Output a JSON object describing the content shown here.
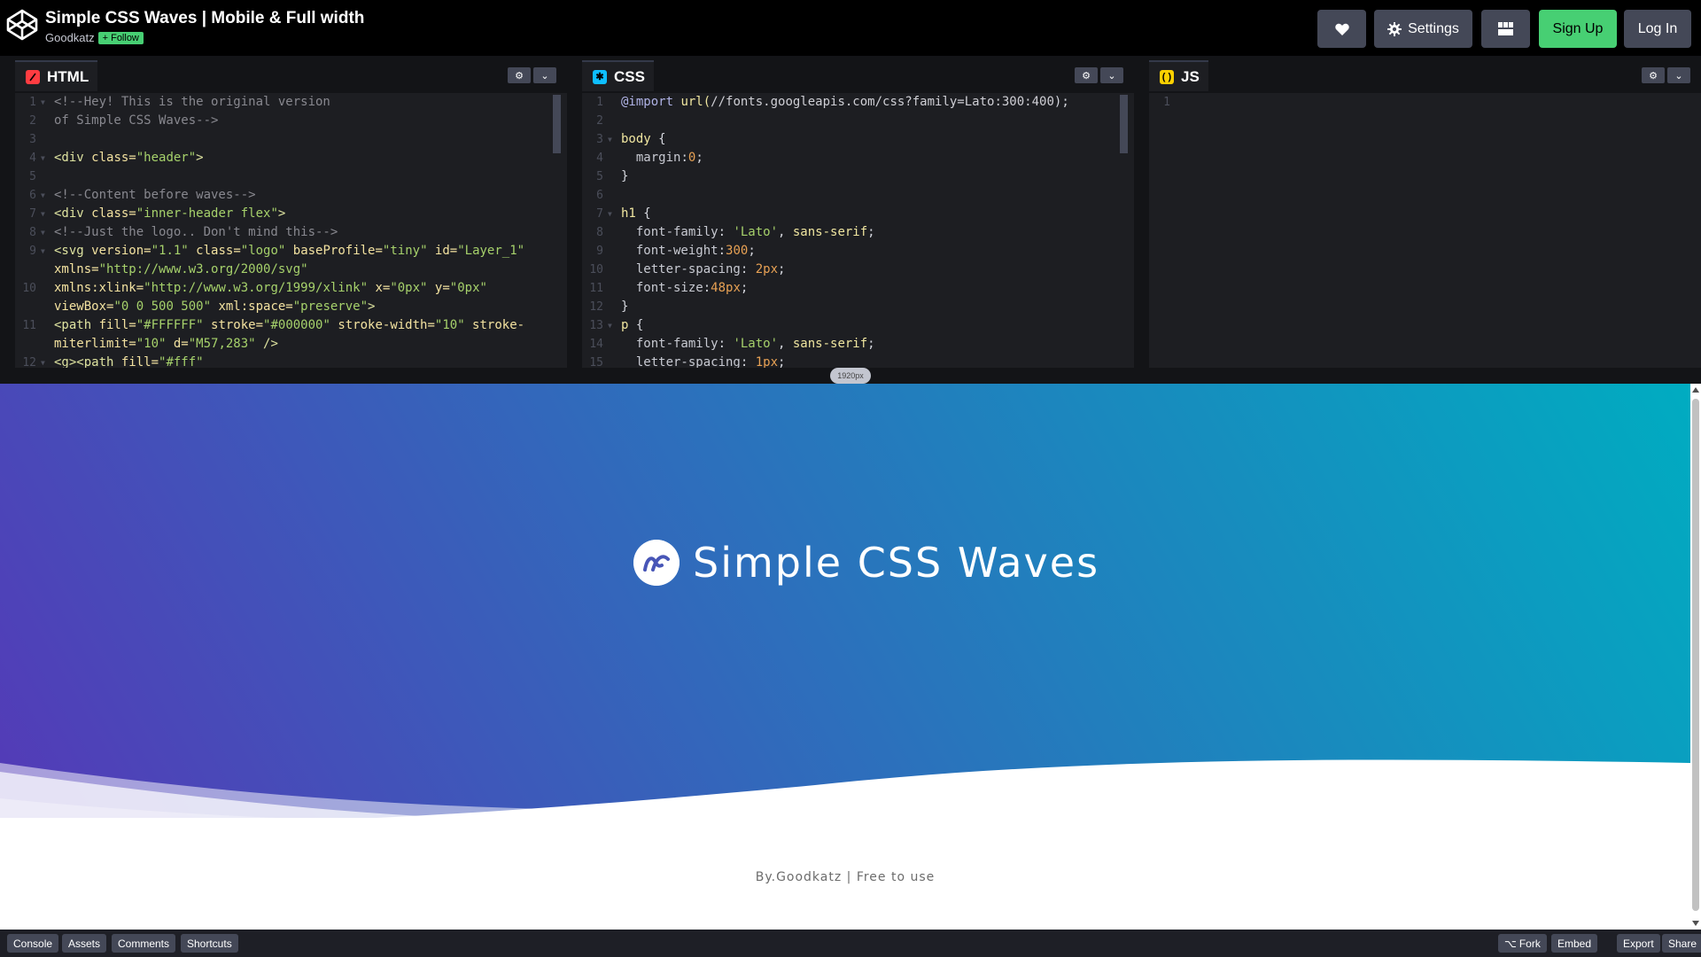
{
  "header": {
    "title": "Simple CSS Waves | Mobile & Full width",
    "author": "Goodkatz",
    "follow_label": "Follow",
    "settings_label": "Settings",
    "signup_label": "Sign Up",
    "login_label": "Log In"
  },
  "editors": {
    "html": {
      "label": "HTML",
      "lines": [
        {
          "n": "1",
          "fold": true,
          "segs": [
            [
              "com",
              "<!--Hey! This is the original version"
            ]
          ]
        },
        {
          "n": "2",
          "fold": false,
          "segs": [
            [
              "com",
              "of Simple CSS Waves-->"
            ]
          ]
        },
        {
          "n": "3",
          "fold": false,
          "segs": []
        },
        {
          "n": "4",
          "fold": true,
          "segs": [
            [
              "tag",
              "<div "
            ],
            [
              "attr",
              "class="
            ],
            [
              "str",
              "\"header\""
            ],
            [
              "tag",
              ">"
            ]
          ]
        },
        {
          "n": "5",
          "fold": false,
          "segs": []
        },
        {
          "n": "6",
          "fold": true,
          "segs": [
            [
              "com",
              "<!--Content before waves-->"
            ]
          ]
        },
        {
          "n": "7",
          "fold": true,
          "segs": [
            [
              "tag",
              "<div "
            ],
            [
              "attr",
              "class="
            ],
            [
              "str",
              "\"inner-header flex\""
            ],
            [
              "tag",
              ">"
            ]
          ]
        },
        {
          "n": "8",
          "fold": true,
          "segs": [
            [
              "com",
              "<!--Just the logo.. Don't mind this-->"
            ]
          ]
        },
        {
          "n": "9",
          "fold": true,
          "segs": [
            [
              "tag",
              "<svg "
            ],
            [
              "attr",
              "version="
            ],
            [
              "str",
              "\"1.1\""
            ],
            [
              "attr",
              " class="
            ],
            [
              "str",
              "\"logo\""
            ],
            [
              "attr",
              " baseProfile="
            ],
            [
              "str",
              "\"tiny\""
            ],
            [
              "attr",
              " id="
            ],
            [
              "str",
              "\"Layer_1\""
            ]
          ]
        },
        {
          "n": "",
          "fold": false,
          "segs": [
            [
              "attr",
              "xmlns="
            ],
            [
              "str",
              "\"http://www.w3.org/2000/svg\""
            ]
          ]
        },
        {
          "n": "10",
          "fold": false,
          "segs": [
            [
              "attr",
              "xmlns:xlink="
            ],
            [
              "str",
              "\"http://www.w3.org/1999/xlink\""
            ],
            [
              "attr",
              " x="
            ],
            [
              "str",
              "\"0px\""
            ],
            [
              "attr",
              " y="
            ],
            [
              "str",
              "\"0px\""
            ]
          ]
        },
        {
          "n": "",
          "fold": false,
          "segs": [
            [
              "attr",
              "viewBox="
            ],
            [
              "str",
              "\"0 0 500 500\""
            ],
            [
              "attr",
              " xml:space="
            ],
            [
              "str",
              "\"preserve\""
            ],
            [
              "tag",
              ">"
            ]
          ]
        },
        {
          "n": "11",
          "fold": false,
          "segs": [
            [
              "tag",
              "<path "
            ],
            [
              "attr",
              "fill="
            ],
            [
              "str",
              "\"#FFFFFF\""
            ],
            [
              "attr",
              " stroke="
            ],
            [
              "str",
              "\"#000000\""
            ],
            [
              "attr",
              " stroke-width="
            ],
            [
              "str",
              "\"10\""
            ],
            [
              "attr",
              " stroke-"
            ]
          ]
        },
        {
          "n": "",
          "fold": false,
          "segs": [
            [
              "attr",
              "miterlimit="
            ],
            [
              "str",
              "\"10\""
            ],
            [
              "attr",
              " d="
            ],
            [
              "str",
              "\"M57,283\""
            ],
            [
              "tag",
              " />"
            ]
          ]
        },
        {
          "n": "12",
          "fold": true,
          "segs": [
            [
              "tag",
              "<g><path "
            ],
            [
              "attr",
              "fill="
            ],
            [
              "str",
              "\"#fff\""
            ]
          ]
        }
      ]
    },
    "css": {
      "label": "CSS",
      "lines": [
        {
          "n": "1",
          "fold": false,
          "segs": [
            [
              "kw",
              "@import "
            ],
            [
              "fn",
              "url("
            ],
            [
              "url",
              "//fonts.googleapis.com/css?family=Lato:300:400"
            ],
            [
              "punct",
              ");"
            ]
          ]
        },
        {
          "n": "2",
          "fold": false,
          "segs": []
        },
        {
          "n": "3",
          "fold": true,
          "segs": [
            [
              "sel",
              "body "
            ],
            [
              "punct",
              "{"
            ]
          ]
        },
        {
          "n": "4",
          "fold": false,
          "segs": [
            [
              "prop",
              "  margin"
            ],
            [
              "punct",
              ":"
            ],
            [
              "num",
              "0"
            ],
            [
              "punct",
              ";"
            ]
          ]
        },
        {
          "n": "5",
          "fold": false,
          "segs": [
            [
              "punct",
              "}"
            ]
          ]
        },
        {
          "n": "6",
          "fold": false,
          "segs": []
        },
        {
          "n": "7",
          "fold": true,
          "segs": [
            [
              "sel",
              "h1 "
            ],
            [
              "punct",
              "{"
            ]
          ]
        },
        {
          "n": "8",
          "fold": false,
          "segs": [
            [
              "prop",
              "  font-family"
            ],
            [
              "punct",
              ": "
            ],
            [
              "str",
              "'Lato'"
            ],
            [
              "punct",
              ", "
            ],
            [
              "sel",
              "sans-serif"
            ],
            [
              "punct",
              ";"
            ]
          ]
        },
        {
          "n": "9",
          "fold": false,
          "segs": [
            [
              "prop",
              "  font-weight"
            ],
            [
              "punct",
              ":"
            ],
            [
              "num",
              "300"
            ],
            [
              "punct",
              ";"
            ]
          ]
        },
        {
          "n": "10",
          "fold": false,
          "segs": [
            [
              "prop",
              "  letter-spacing"
            ],
            [
              "punct",
              ": "
            ],
            [
              "num",
              "2px"
            ],
            [
              "punct",
              ";"
            ]
          ]
        },
        {
          "n": "11",
          "fold": false,
          "segs": [
            [
              "prop",
              "  font-size"
            ],
            [
              "punct",
              ":"
            ],
            [
              "num",
              "48px"
            ],
            [
              "punct",
              ";"
            ]
          ]
        },
        {
          "n": "12",
          "fold": false,
          "segs": [
            [
              "punct",
              "}"
            ]
          ]
        },
        {
          "n": "13",
          "fold": true,
          "segs": [
            [
              "sel",
              "p "
            ],
            [
              "punct",
              "{"
            ]
          ]
        },
        {
          "n": "14",
          "fold": false,
          "segs": [
            [
              "prop",
              "  font-family"
            ],
            [
              "punct",
              ": "
            ],
            [
              "str",
              "'Lato'"
            ],
            [
              "punct",
              ", "
            ],
            [
              "sel",
              "sans-serif"
            ],
            [
              "punct",
              ";"
            ]
          ]
        },
        {
          "n": "15",
          "fold": false,
          "segs": [
            [
              "prop",
              "  letter-spacing"
            ],
            [
              "punct",
              ": "
            ],
            [
              "num",
              "1px"
            ],
            [
              "punct",
              ";"
            ]
          ]
        }
      ]
    },
    "js": {
      "label": "JS",
      "lines": [
        {
          "n": "1",
          "fold": false,
          "segs": []
        }
      ]
    }
  },
  "resizer": {
    "width_badge": "1920px"
  },
  "preview": {
    "hero_title": "Simple CSS Waves",
    "footer_text": "By.Goodkatz | Free to use",
    "gradient": [
      "#543ab7",
      "#00acc1"
    ]
  },
  "bottom_bar": {
    "left": [
      "Console",
      "Assets",
      "Comments",
      "Shortcuts"
    ],
    "fork_label": "Fork",
    "embed_label": "Embed",
    "export_label": "Export",
    "share_label": "Share"
  },
  "colors": {
    "accent_green": "#47cf73",
    "html_icon": "#ff3c41",
    "css_icon": "#0ebeff",
    "js_icon": "#fcd000",
    "button_gray": "#444857"
  }
}
